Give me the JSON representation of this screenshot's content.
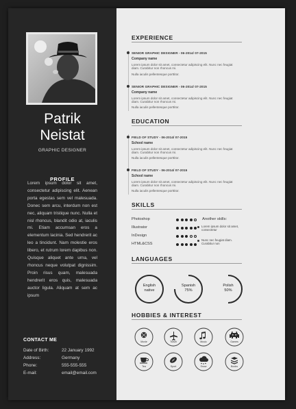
{
  "sidebar": {
    "first_name": "Patrik",
    "last_name": "Neistat",
    "title": "GRAPHIC DESIGNER",
    "profile_heading": "PROFILE",
    "profile_text": "Lorem ipsum dolor sit amet, consectetur adipiscing elit. Aenean porta egestas sem vel malesuada. Donec sem arcu, interdum non est nec, aliquam tristique nunc. Nulla et nisl rhoncus, blandit odio at, iaculis mi. Etiam accumsan eros a elementum lacinia. Sed hendrerit ac leo a tincidunt. Nam molestie eros libero, et rutrum lorem dapibus non. Quisque aliquet ante urna, vel rhoncus neque volutpat dignissim. Proin risus quam, malesuada hendrerit eros quis, malesuada auctor ligula. Aliquam at sem ac ipsum",
    "contact_heading": "CONTACT ME",
    "contact": [
      {
        "label": "Date of Birth:",
        "value": "22 January 1992"
      },
      {
        "label": "Address:",
        "value": "Germany"
      },
      {
        "label": "Phone:",
        "value": "555-555-555"
      },
      {
        "label": "E-mail:",
        "value": "email@email.com"
      }
    ]
  },
  "experience": {
    "heading": "EXPERIENCE",
    "entries": [
      {
        "title": "SENIOR GRAPHIC DESIGNER - 06-2014/ 07-2015",
        "company": "Company name",
        "body": "Lorem ipsum dolor sit amet, consectetur adipiscing elit. Nunc nec feugiat diam. Curabitur non rhoncus mi.",
        "note": "Nulla iaculis pellentesque porttitor."
      },
      {
        "title": "SENIOR GRAPHIC DESIGNER - 06-2014/ 07-2015",
        "company": "Company name",
        "body": "Lorem ipsum dolor sit amet, consectetur adipiscing elit. Nunc nec feugiat diam. Curabitur non rhoncus mi.",
        "note": "Nulla iaculis pellentesque porttitor."
      }
    ]
  },
  "education": {
    "heading": "EDUCATION",
    "entries": [
      {
        "title": "FIELD OF STUDY - 06-2014/ 07-2015",
        "school": "School name",
        "body": "Lorem ipsum dolor sit amet, consectetur adipiscing elit. Nunc nec feugiat diam. Curabitur non rhoncus mi.",
        "note": "Nulla iaculis pellentesque porttitor."
      },
      {
        "title": "FIELD OF STUDY - 06-2014/ 07-2015",
        "school": "School name",
        "body": "Lorem ipsum dolor sit amet, consectetur adipiscing elit. Nunc nec feugiat diam. Curabitur non rhoncus mi.",
        "note": "Nulla iaculis pellentesque porttitor."
      }
    ]
  },
  "skills": {
    "heading": "SKILLS",
    "items": [
      {
        "name": "Photoshop",
        "level": 4,
        "max": 5
      },
      {
        "name": "Illustrator",
        "level": 5,
        "max": 5
      },
      {
        "name": "InDesign",
        "level": 3,
        "max": 5
      },
      {
        "name": "HTML&CSS",
        "level": 5,
        "max": 5
      }
    ],
    "another_heading": "Another skills:",
    "another_items": [
      "Lorem ipsum dolor sit amet, consectetur",
      "Nunc nec feugiat diam. Curabitur non"
    ]
  },
  "languages": {
    "heading": "LANGUAGES",
    "items": [
      {
        "line1": "English",
        "line2": "native",
        "fraction": 1.0
      },
      {
        "line1": "Spanish",
        "line2": "75%",
        "fraction": 0.75
      },
      {
        "line1": "Polish",
        "line2": "50%",
        "fraction": 0.5
      }
    ]
  },
  "hobbies": {
    "heading": "HOBBIES & INTEREST",
    "items": [
      {
        "label": "Movie",
        "icon": "movie-icon"
      },
      {
        "label": "Travel",
        "icon": "airplane-icon"
      },
      {
        "label": "Music",
        "icon": "music-note-icon"
      },
      {
        "label": "Games",
        "icon": "space-invader-icon"
      },
      {
        "label": "Tea",
        "icon": "tea-cup-icon"
      },
      {
        "label": "Sport",
        "icon": "football-icon"
      },
      {
        "label": "Snow",
        "icon": "snow-cloud-icon"
      },
      {
        "label": "Books",
        "icon": "books-icon"
      }
    ]
  },
  "colors": {
    "sidebar": "#262626",
    "page": "#ececec",
    "ink": "#222222"
  }
}
